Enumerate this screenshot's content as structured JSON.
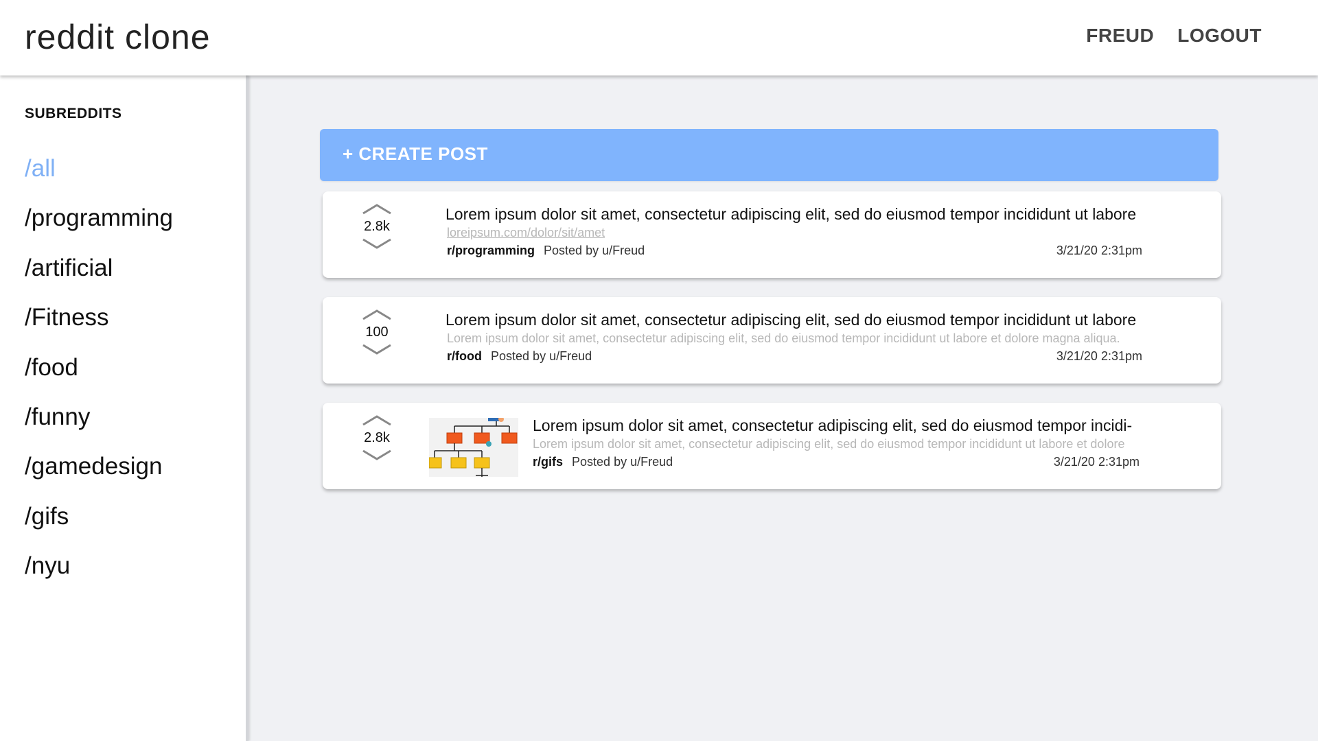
{
  "header": {
    "brand": "reddit clone",
    "user_label": "FREUD",
    "logout_label": "LOGOUT"
  },
  "sidebar": {
    "title": "SUBREDDITS",
    "items": [
      {
        "label": "/all",
        "active": true
      },
      {
        "label": "/programming"
      },
      {
        "label": "/artificial"
      },
      {
        "label": "/Fitness"
      },
      {
        "label": "/food"
      },
      {
        "label": "/funny"
      },
      {
        "label": "/gamedesign"
      },
      {
        "label": "/gifs"
      },
      {
        "label": "/nyu"
      }
    ]
  },
  "main": {
    "create_post_label": "+ CREATE POST",
    "posts": [
      {
        "score": "2.8k",
        "title": "Lorem ipsum dolor sit amet, consectetur adipiscing elit, sed do eiusmod tempor incididunt ut labore",
        "subtext": "loreipsum.com/dolor/sit/amet",
        "subreddit": "r/programming",
        "posted_by": "Posted by u/Freud",
        "date": "3/21/20 2:31pm"
      },
      {
        "score": "100",
        "title": "Lorem ipsum dolor sit amet, consectetur adipiscing elit, sed do eiusmod tempor incididunt ut labore",
        "subtext": "Lorem ipsum dolor sit amet, consectetur adipiscing elit, sed do eiusmod tempor incididunt ut labore et dolore magna aliqua.",
        "subreddit": "r/food",
        "posted_by": "Posted by u/Freud",
        "date": "3/21/20 2:31pm"
      },
      {
        "score": "2.8k",
        "title": "Lorem ipsum dolor sit amet, consectetur adipiscing elit, sed do eiusmod tempor incidi-",
        "subtext": "Lorem ipsum dolor sit amet, consectetur adipiscing elit, sed do eiusmod tempor incididunt ut labore et dolore",
        "subreddit": "r/gifs",
        "posted_by": "Posted by u/Freud",
        "date": "3/21/20 2:31pm"
      }
    ]
  },
  "colors": {
    "accent": "#80b4fd",
    "active_subreddit": "#7fb0f5",
    "background": "#f0f1f4"
  },
  "icons": {
    "upvote": "chevron-up-icon",
    "downvote": "chevron-down-icon",
    "thumbnail": "flowchart-thumbnail"
  }
}
